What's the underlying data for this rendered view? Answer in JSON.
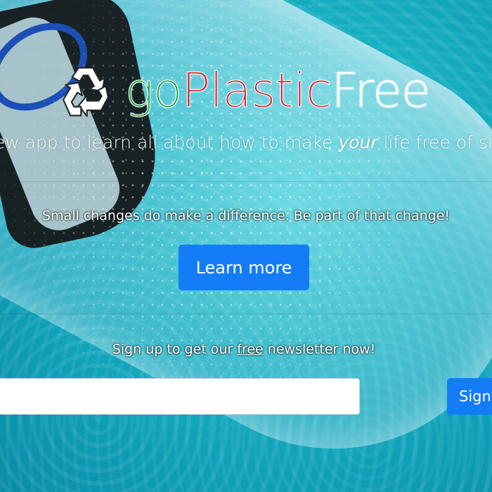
{
  "brand": {
    "part_go": "go",
    "part_plastic": "Plastic",
    "part_free": "Free",
    "logo_icon": "recycle-icon",
    "colors": {
      "go": "#2aa043",
      "plastic": "#d81c2b",
      "free": "#ffffff"
    }
  },
  "hero": {
    "tagline_before": "new app to learn all about how to make ",
    "tagline_emphasis": "your",
    "tagline_after": " life free of sing",
    "changes_text": "Small changes do make a difference. Be part of that change!",
    "learn_more_label": "Learn more"
  },
  "newsletter": {
    "text_before": "Sign up to get our ",
    "text_underlined": "free",
    "text_after": " newsletter now!",
    "email_value": "",
    "email_placeholder": "",
    "submit_label": "Sign up"
  },
  "theme": {
    "button_primary": "#137cf6",
    "background_water": "#18b3c4"
  }
}
